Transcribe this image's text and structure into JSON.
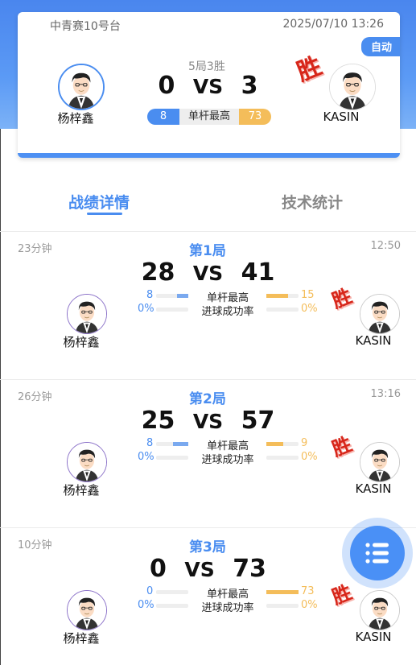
{
  "header": {
    "venue": "中青赛10号台",
    "datetime": "2025/07/10 13:26",
    "auto_badge": "自动",
    "format": "5局3胜",
    "score_left": "0",
    "vs": "VS",
    "score_right": "3",
    "player_left": "杨梓鑫",
    "player_right": "KASIN",
    "win_mark": "胜",
    "highest_break_left": "8",
    "highest_break_label": "单杆最高",
    "highest_break_right": "73"
  },
  "tabs": {
    "details": "战绩详情",
    "stats": "技术统计"
  },
  "games": [
    {
      "duration": "23分钟",
      "title": "第1局",
      "time": "12:50",
      "score_left": "28",
      "vs": "VS",
      "score_right": "41",
      "break_left": "8",
      "break_label": "单杆最高",
      "break_right": "15",
      "rate_left": "0%",
      "rate_label": "进球成功率",
      "rate_right": "0%",
      "player_left": "杨梓鑫",
      "player_right": "KASIN",
      "win_mark": "胜"
    },
    {
      "duration": "26分钟",
      "title": "第2局",
      "time": "13:16",
      "score_left": "25",
      "vs": "VS",
      "score_right": "57",
      "break_left": "8",
      "break_label": "单杆最高",
      "break_right": "9",
      "rate_left": "0%",
      "rate_label": "进球成功率",
      "rate_right": "0%",
      "player_left": "杨梓鑫",
      "player_right": "KASIN",
      "win_mark": "胜"
    },
    {
      "duration": "10分钟",
      "title": "第3局",
      "time": "",
      "score_left": "0",
      "vs": "VS",
      "score_right": "73",
      "break_left": "0",
      "break_label": "单杆最高",
      "break_right": "73",
      "rate_left": "0%",
      "rate_label": "进球成功率",
      "rate_right": "0%",
      "player_left": "杨梓鑫",
      "player_right": "KASIN",
      "win_mark": "胜"
    }
  ],
  "icons": {
    "fab": "list-icon",
    "avatar": "avatar-icon"
  },
  "colors": {
    "accent": "#4a8df0",
    "orange": "#f4bd5a",
    "win_red": "#d7261a"
  }
}
